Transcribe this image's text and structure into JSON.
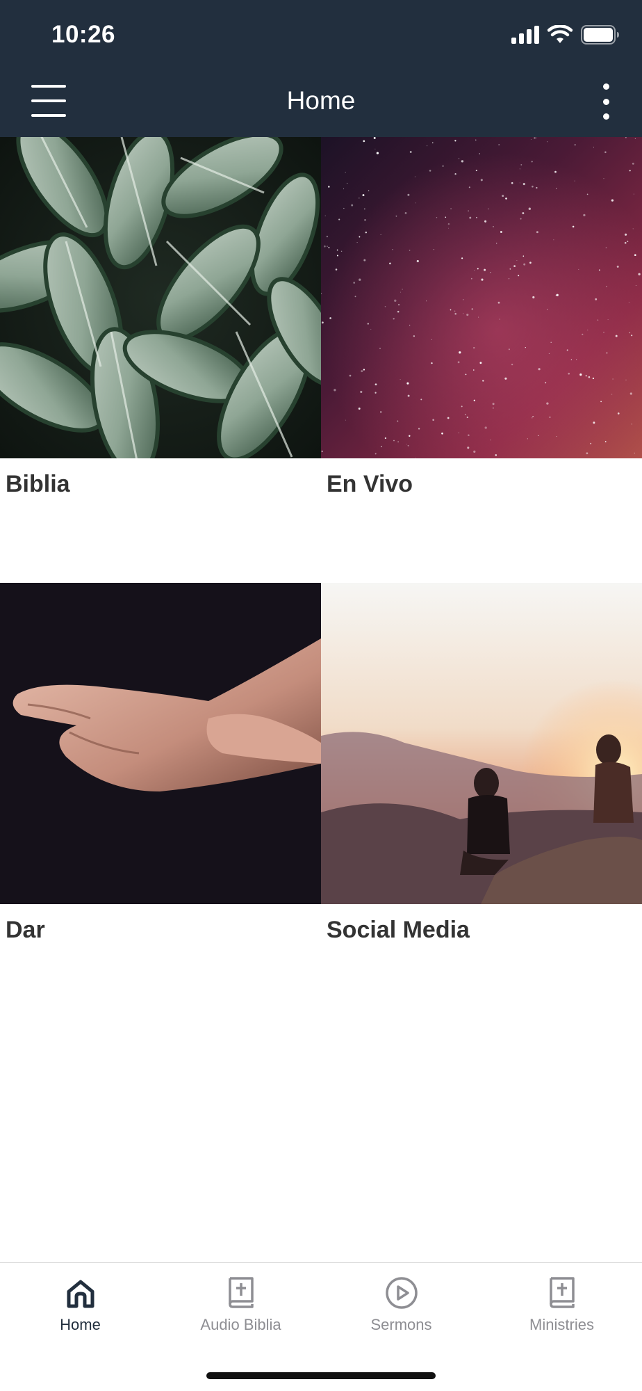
{
  "theme": {
    "header_bg": "#222f3e",
    "tile_label_color": "#333333",
    "tab_active_color": "#222f3e",
    "tab_inactive_color": "#8e8e93"
  },
  "status_bar": {
    "time": "10:26",
    "icons": [
      "cellular-signal-icon",
      "wifi-icon",
      "battery-icon"
    ]
  },
  "nav_bar": {
    "title": "Home",
    "left_icon": "hamburger-menu-icon",
    "right_icon": "more-vertical-icon"
  },
  "tiles": [
    {
      "label": "Biblia",
      "image": "green-leaves-photo"
    },
    {
      "label": "En Vivo",
      "image": "starry-night-sky-photo"
    },
    {
      "label": "Dar",
      "image": "open-hands-photo"
    },
    {
      "label": "Social Media",
      "image": "people-on-mountain-sunset-photo"
    }
  ],
  "tab_bar": {
    "tabs": [
      {
        "label": "Home",
        "icon": "home-icon",
        "active": true
      },
      {
        "label": "Audio Biblia",
        "icon": "bible-icon",
        "active": false
      },
      {
        "label": "Sermons",
        "icon": "play-circle-icon",
        "active": false
      },
      {
        "label": "Ministries",
        "icon": "bible-icon",
        "active": false
      }
    ]
  }
}
